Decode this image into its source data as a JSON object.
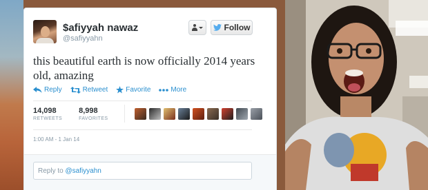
{
  "tweet": {
    "display_name": "$afiyyah nawaz",
    "handle": "@safiyyahn",
    "follow_label": "Follow",
    "text": "this beautiful earth is now officially 2014 years old, amazing",
    "actions": {
      "reply": "Reply",
      "retweet": "Retweet",
      "favorite": "Favorite",
      "more": "More"
    },
    "stats": {
      "retweets_count": "14,098",
      "retweets_label": "RETWEETS",
      "favorites_count": "8,998",
      "favorites_label": "FAVORITES"
    },
    "timestamp": "1:00 AM - 1 Jan 14",
    "reply_prefix": "Reply to ",
    "reply_mention": "@safiyyahn"
  },
  "icons": [
    "person-icon",
    "caret-down-icon",
    "twitter-bird-icon",
    "reply-icon",
    "retweet-icon",
    "star-icon",
    "more-dots-icon"
  ],
  "colors": {
    "link_blue": "#2a8fcf",
    "twitter_blue": "#55acee",
    "text_dark": "#292f33",
    "text_muted": "#8899a6"
  }
}
